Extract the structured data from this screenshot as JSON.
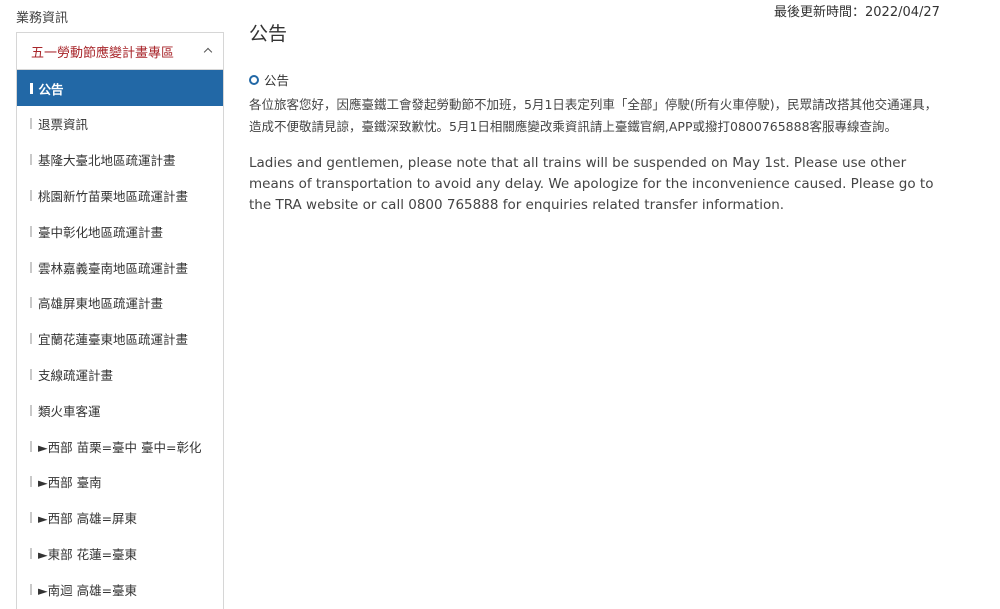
{
  "sidebar": {
    "title": "業務資訊",
    "header": "五一勞動節應變計畫專區",
    "items": [
      {
        "label": "公告",
        "active": true
      },
      {
        "label": "退票資訊",
        "active": false
      },
      {
        "label": "基隆大臺北地區疏運計畫",
        "active": false
      },
      {
        "label": "桃園新竹苗栗地區疏運計畫",
        "active": false
      },
      {
        "label": "臺中彰化地區疏運計畫",
        "active": false
      },
      {
        "label": "雲林嘉義臺南地區疏運計畫",
        "active": false
      },
      {
        "label": "高雄屏東地區疏運計畫",
        "active": false
      },
      {
        "label": "宜蘭花蓮臺東地區疏運計畫",
        "active": false
      },
      {
        "label": "支線疏運計畫",
        "active": false
      },
      {
        "label": "類火車客運",
        "active": false
      },
      {
        "label": "►西部 苗栗=臺中 臺中=彰化",
        "active": false
      },
      {
        "label": "►西部 臺南",
        "active": false
      },
      {
        "label": "►西部 高雄=屏東",
        "active": false
      },
      {
        "label": "►東部 花蓮=臺東",
        "active": false
      },
      {
        "label": "►南迴 高雄=臺東",
        "active": false
      }
    ]
  },
  "header": {
    "last_updated": "最後更新時間：2022/04/27"
  },
  "main": {
    "title": "公告",
    "section_title": "公告",
    "paragraph_zh": "各位旅客您好，因應臺鐵工會發起勞動節不加班，5月1日表定列車「全部」停駛(所有火車停駛)，民眾請改搭其他交通運具，造成不便敬請見諒，臺鐵深致歉忱。5月1日相關應變改乘資訊請上臺鐵官網,APP或撥打0800765888客服專線查詢。",
    "paragraph_en": "Ladies and gentlemen, please note that all trains will be suspended on May 1st. Please use other means of transportation to avoid any delay. We apologize for the inconvenience caused. Please go to the TRA website or call 0800 765888 for enquiries related transfer information."
  },
  "colors": {
    "accent_blue": "#2268a6",
    "header_red": "#a8262b"
  }
}
